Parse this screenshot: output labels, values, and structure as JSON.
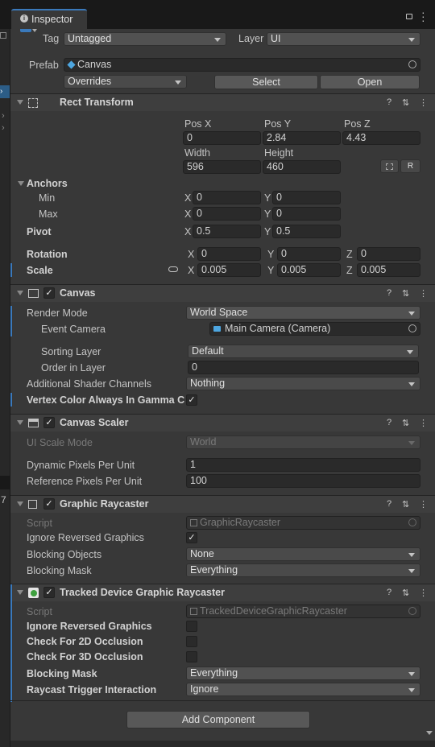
{
  "tab": {
    "title": "Inspector"
  },
  "go": {
    "tag_label": "Tag",
    "tag_value": "Untagged",
    "layer_label": "Layer",
    "layer_value": "UI",
    "prefab_label": "Prefab",
    "prefab_value": "Canvas",
    "overrides": "Overrides",
    "select": "Select",
    "open": "Open"
  },
  "rect": {
    "title": "Rect Transform",
    "pos_x_label": "Pos X",
    "pos_y_label": "Pos Y",
    "pos_z_label": "Pos Z",
    "pos_x": "0",
    "pos_y": "2.84",
    "pos_z": "4.43",
    "width_label": "Width",
    "height_label": "Height",
    "width": "596",
    "height": "460",
    "anchors": "Anchors",
    "min": "Min",
    "max": "Max",
    "min_x": "0",
    "min_y": "0",
    "max_x": "0",
    "max_y": "0",
    "pivot": "Pivot",
    "pivot_x": "0.5",
    "pivot_y": "0.5",
    "rotation": "Rotation",
    "rot_x": "0",
    "rot_y": "0",
    "rot_z": "0",
    "scale": "Scale",
    "scale_x": "0.005",
    "scale_y": "0.005",
    "scale_z": "0.005",
    "x": "X",
    "y": "Y",
    "z": "Z",
    "r_btn": "R"
  },
  "canvas": {
    "title": "Canvas",
    "render_mode_label": "Render Mode",
    "render_mode": "World Space",
    "event_camera_label": "Event Camera",
    "event_camera": "Main Camera (Camera)",
    "sorting_layer_label": "Sorting Layer",
    "sorting_layer": "Default",
    "order_label": "Order in Layer",
    "order": "0",
    "shader_label": "Additional Shader Channels",
    "shader": "Nothing",
    "vertex_label": "Vertex Color Always In Gamma Co"
  },
  "scaler": {
    "title": "Canvas Scaler",
    "ui_scale_label": "UI Scale Mode",
    "ui_scale": "World",
    "dyn_label": "Dynamic Pixels Per Unit",
    "dyn": "1",
    "ref_label": "Reference Pixels Per Unit",
    "ref": "100"
  },
  "raycaster": {
    "title": "Graphic Raycaster",
    "script_label": "Script",
    "script": "GraphicRaycaster",
    "ignore_label": "Ignore Reversed Graphics",
    "blocking_obj_label": "Blocking Objects",
    "blocking_obj": "None",
    "blocking_mask_label": "Blocking Mask",
    "blocking_mask": "Everything"
  },
  "tracked": {
    "title": "Tracked Device Graphic Raycaster",
    "script_label": "Script",
    "script": "TrackedDeviceGraphicRaycaster",
    "ignore_label": "Ignore Reversed Graphics",
    "check2d_label": "Check For 2D Occlusion",
    "check3d_label": "Check For 3D Occlusion",
    "blocking_mask_label": "Blocking Mask",
    "blocking_mask": "Everything",
    "trigger_label": "Raycast Trigger Interaction",
    "trigger": "Ignore"
  },
  "footer": {
    "add_component": "Add Component"
  },
  "left_strip": {
    "num": "7"
  },
  "colors": {
    "accent": "#3a79bb",
    "panel": "#383838",
    "field": "#2a2a2a"
  }
}
